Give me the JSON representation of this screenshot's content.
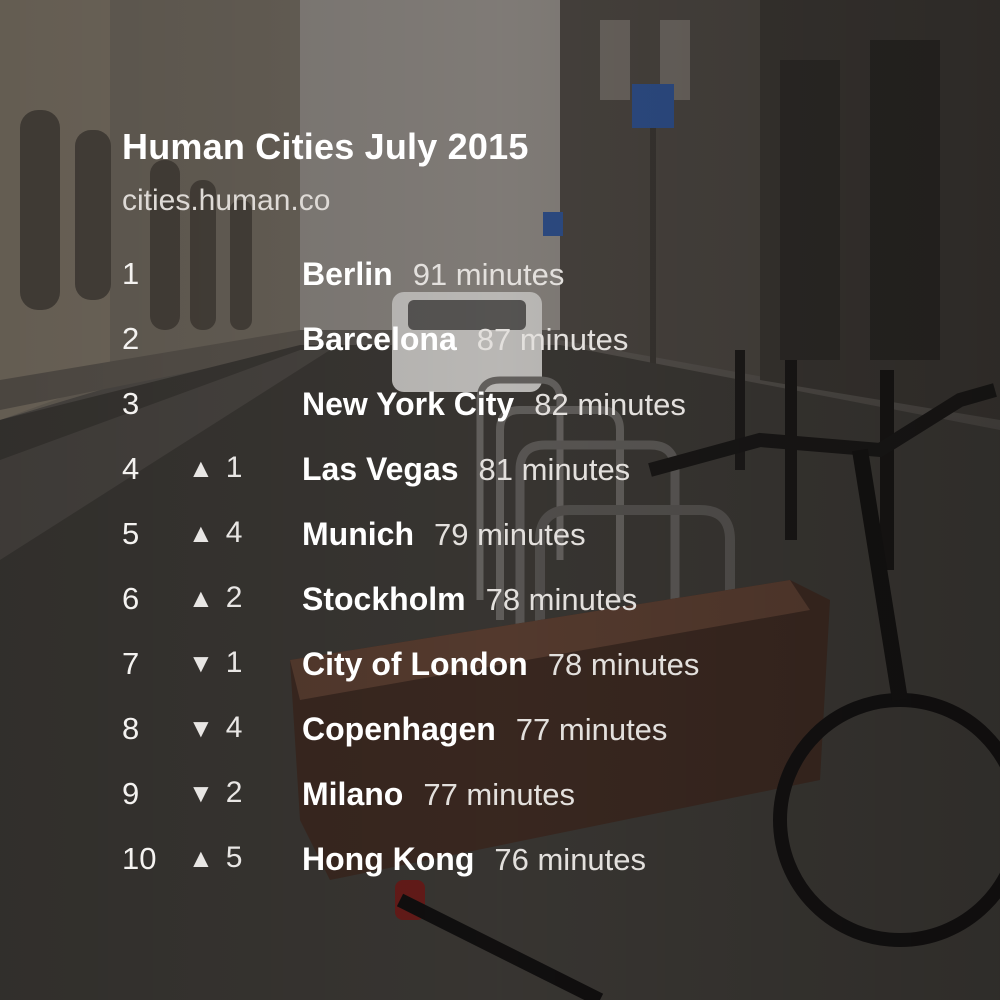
{
  "title": "Human Cities July 2015",
  "subtitle": "cities.human.co",
  "rankings": [
    {
      "rank": "1",
      "arrow": "",
      "change": "",
      "city": "Berlin",
      "minutes": "91 minutes"
    },
    {
      "rank": "2",
      "arrow": "",
      "change": "",
      "city": "Barcelona",
      "minutes": "87 minutes"
    },
    {
      "rank": "3",
      "arrow": "",
      "change": "",
      "city": "New York City",
      "minutes": "82 minutes"
    },
    {
      "rank": "4",
      "arrow": "▲",
      "change": "1",
      "city": "Las Vegas",
      "minutes": "81 minutes"
    },
    {
      "rank": "5",
      "arrow": "▲",
      "change": "4",
      "city": "Munich",
      "minutes": "79 minutes"
    },
    {
      "rank": "6",
      "arrow": "▲",
      "change": "2",
      "city": "Stockholm",
      "minutes": "78 minutes"
    },
    {
      "rank": "7",
      "arrow": "▼",
      "change": "1",
      "city": "City of London",
      "minutes": "78 minutes"
    },
    {
      "rank": "8",
      "arrow": "▼",
      "change": "4",
      "city": "Copenhagen",
      "minutes": "77 minutes"
    },
    {
      "rank": "9",
      "arrow": "▼",
      "change": "2",
      "city": "Milano",
      "minutes": "77 minutes"
    },
    {
      "rank": "10",
      "arrow": "▲",
      "change": "5",
      "city": "Hong Kong",
      "minutes": "76 minutes"
    }
  ]
}
